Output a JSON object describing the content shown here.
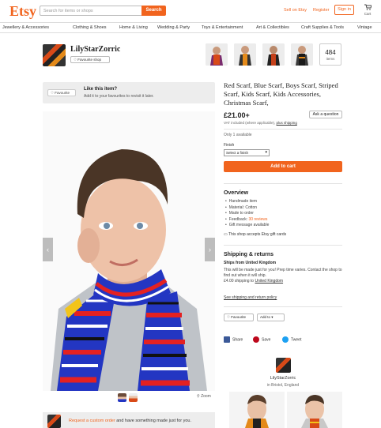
{
  "header": {
    "logo": "Etsy",
    "search_placeholder": "Search for items or shops",
    "search_button": "Search",
    "sell_link": "Sell on Etsy",
    "register_link": "Register",
    "signin_button": "Sign in",
    "cart_label": "Cart"
  },
  "nav": {
    "items": [
      "Jewellery & Accessories",
      "Clothing & Shoes",
      "Home & Living",
      "Wedding & Party",
      "Toys & Entertainment",
      "Art & Collectibles",
      "Craft Supplies & Tools",
      "Vintage"
    ]
  },
  "shop": {
    "name": "LilyStarZorric",
    "favourite_shop": "Favourite shop",
    "item_count": "484",
    "item_count_label": "items"
  },
  "like": {
    "button": "Favourite",
    "title": "Like this item?",
    "subtitle": "Add it to your favourites to revisit it later."
  },
  "gallery": {
    "zoom_label": "Zoom"
  },
  "custom_order": {
    "link": "Request a custom order",
    "text": " and have something made just for you."
  },
  "listing": {
    "title": "Red Scarf, Blue Scarf, Boys Scarf, Striped Scarf, Kids Scarf, Kids Accessories, Christmas Scarf,",
    "price": "£21.00+",
    "ask_button": "Ask a question",
    "vat_text": "VAT included (where applicable), ",
    "vat_link": "plus shipping",
    "availability": "Only 1 available",
    "finish_label": "Finish",
    "finish_value": "Select a finish",
    "add_to_cart": "Add to cart"
  },
  "overview": {
    "heading": "Overview",
    "items": [
      "Handmade item",
      "Material: Cotton",
      "Made to order"
    ],
    "feedback_prefix": "Feedback: ",
    "feedback_link": "30 reviews",
    "gift": "Gift message available",
    "gift_cards": "This shop accepts Etsy gift cards"
  },
  "shipping": {
    "heading": "Shipping & returns",
    "from": "Ships from United Kingdom",
    "text": "This will be made just for you! Prep time varies. Contact the shop to find out when it will ship.",
    "cost_prefix": "£4.00 shipping to ",
    "cost_link": "United Kingdom",
    "policy_link": "See shipping and return policy"
  },
  "actions": {
    "favourite": "Favourite",
    "add_to": "Add to"
  },
  "social": {
    "share": "Share",
    "save": "Save",
    "tweet": "Tweet"
  },
  "seller": {
    "name": "LilyStarZorric",
    "location": "in Bristol, England"
  },
  "colors": {
    "accent": "#f1641e",
    "facebook": "#3b5998",
    "pinterest": "#bd081c",
    "twitter": "#1da1f2"
  }
}
